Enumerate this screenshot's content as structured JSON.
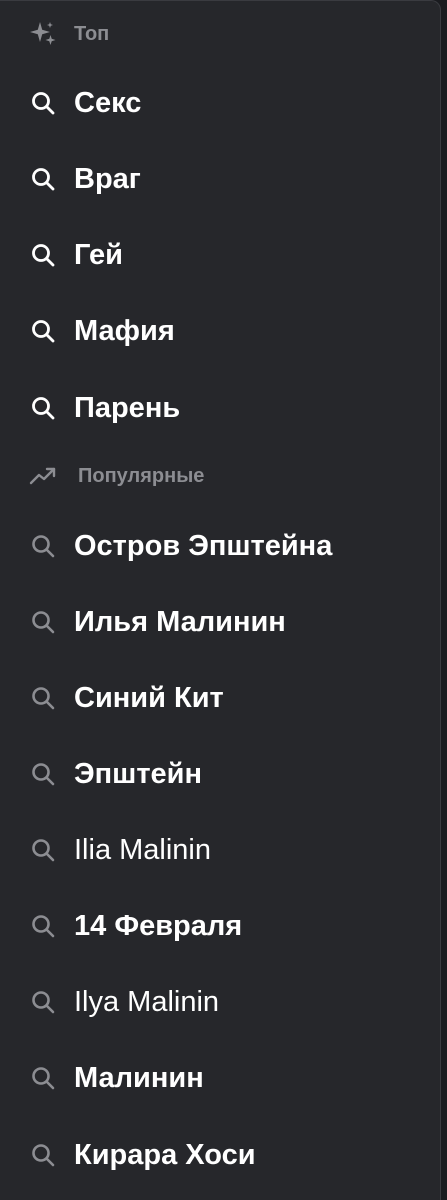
{
  "sections": {
    "top": {
      "title": "Топ",
      "icon": "sparkle-icon",
      "items": [
        {
          "label": "Секс"
        },
        {
          "label": "Враг"
        },
        {
          "label": "Гей"
        },
        {
          "label": "Мафия"
        },
        {
          "label": "Парень"
        }
      ]
    },
    "popular": {
      "title": "Популярные",
      "icon": "trending-up-icon",
      "items": [
        {
          "label": "Остров Эпштейна"
        },
        {
          "label": "Илья Малинин"
        },
        {
          "label": "Синий Кит"
        },
        {
          "label": "Эпштейн"
        },
        {
          "label": "Ilia Malinin"
        },
        {
          "label": "14 Февраля"
        },
        {
          "label": "Ilya Malinin"
        },
        {
          "label": "Малинин"
        },
        {
          "label": "Кирара Хоси"
        }
      ]
    }
  },
  "colors": {
    "background": "#26272b",
    "header_text": "#8c8d92",
    "top_search_icon": "#ffffff",
    "popular_search_icon": "#8c8d92",
    "item_text": "#ffffff"
  }
}
